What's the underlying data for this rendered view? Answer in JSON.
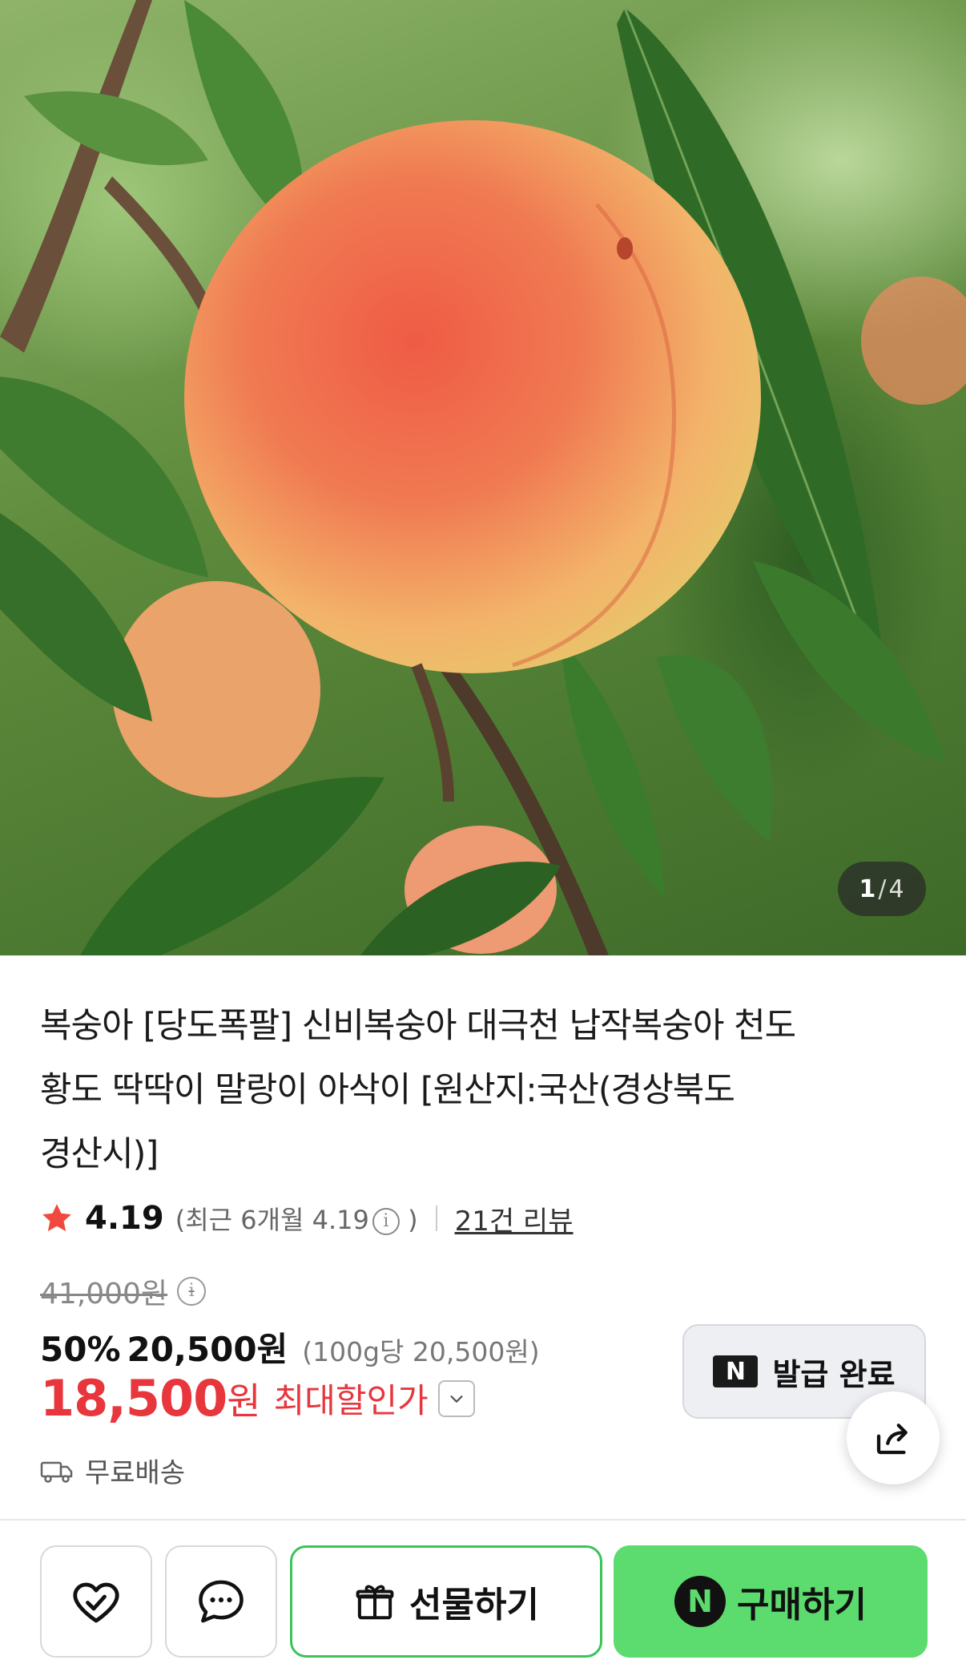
{
  "hero": {
    "page_current": "1",
    "page_total": "4"
  },
  "product": {
    "title_line1": "복숭아 [당도폭팔] 신비복숭아 대극천 납작복숭아 천도",
    "title_line2": "황도 딱딱이 말랑이 아삭이 [원산지:국산(경상북도",
    "title_line3": "경산시)]",
    "rating": "4.19",
    "rating_recent": "(최근 6개월 4.19",
    "rating_recent_close": ")",
    "review_count": "21건 리뷰",
    "original_price": "41,000원",
    "discount_percent": "50%",
    "sale_price": "20,500원",
    "unit_price": "(100g당 20,500원)",
    "final_price": "18,500",
    "final_price_unit": "원",
    "final_label": "최대할인가",
    "shipping": "무료배송"
  },
  "coupon": {
    "logo": "N",
    "label": "발급 완료"
  },
  "actions": {
    "like_icon": "heart-check-icon",
    "talk_icon": "chat-bubble-icon",
    "gift_label": "선물하기",
    "buy_badge": "N",
    "buy_label": "구매하기"
  },
  "colors": {
    "accent_red": "#e8363d",
    "naver_green": "#5cdb6e",
    "gift_border": "#3cc35a"
  }
}
